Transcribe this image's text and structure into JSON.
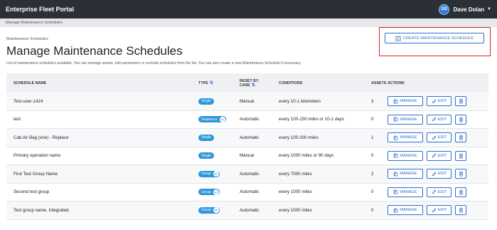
{
  "app": {
    "title": "Enterprise Fleet Portal"
  },
  "user": {
    "initials": "DD",
    "name": "Dave Dolan"
  },
  "breadcrumb": {
    "top": "Manage Maintenance Schedules",
    "sub": "Maintenance Schedules"
  },
  "page": {
    "title": "Manage Maintenance Schedules",
    "description": "List of maintenance schedules available. You can manage assets, edit parameters or exclude schedules from the list. You can also create a new Maintenance Schedule if necessary.",
    "create_label": "CREATE MAINTENANCE SCHEDULE"
  },
  "table": {
    "headers": {
      "name": "SCHEDULE NAME",
      "type": "TYPE",
      "reset_line1": "RESET BY",
      "reset_line2": "CASE",
      "conditions": "CONDITIONS",
      "assets": "ASSETS",
      "actions": "ACTIONS"
    },
    "action_labels": {
      "manage": "MANAGE",
      "edit": "EDIT"
    },
    "rows": [
      {
        "name": "Test-user-1424",
        "type": "Single",
        "reset": "Manual",
        "conditions": "every 10-1 kilometers",
        "assets": "3"
      },
      {
        "name": "test",
        "type": "Sequence",
        "reset": "Automatic",
        "conditions": "every 100-150 miles or 10-1 days",
        "assets": "0"
      },
      {
        "name": "Cab Air Bag (one) - Replace",
        "type": "Single",
        "reset": "Automatic",
        "conditions": "every 100-200 miles",
        "assets": "1"
      },
      {
        "name": "Primary operation name",
        "type": "Single",
        "reset": "Manual",
        "conditions": "every 1000 miles or 90 days",
        "assets": "0"
      },
      {
        "name": "First Test Group Name",
        "type": "Group",
        "reset": "Automatic",
        "conditions": "every 7000 miles",
        "assets": "2"
      },
      {
        "name": "Second test group",
        "type": "Group",
        "reset": "Automatic",
        "conditions": "every 1000 miles",
        "assets": "0"
      },
      {
        "name": "Test group name. Integrated.",
        "type": "Group",
        "reset": "Automatic",
        "conditions": "every 1000 miles",
        "assets": "0"
      }
    ]
  },
  "colors": {
    "accent": "#2f6fcf",
    "pill": "#2e95d8",
    "topbar": "#2b2f36",
    "highlight": "#d9222a"
  }
}
